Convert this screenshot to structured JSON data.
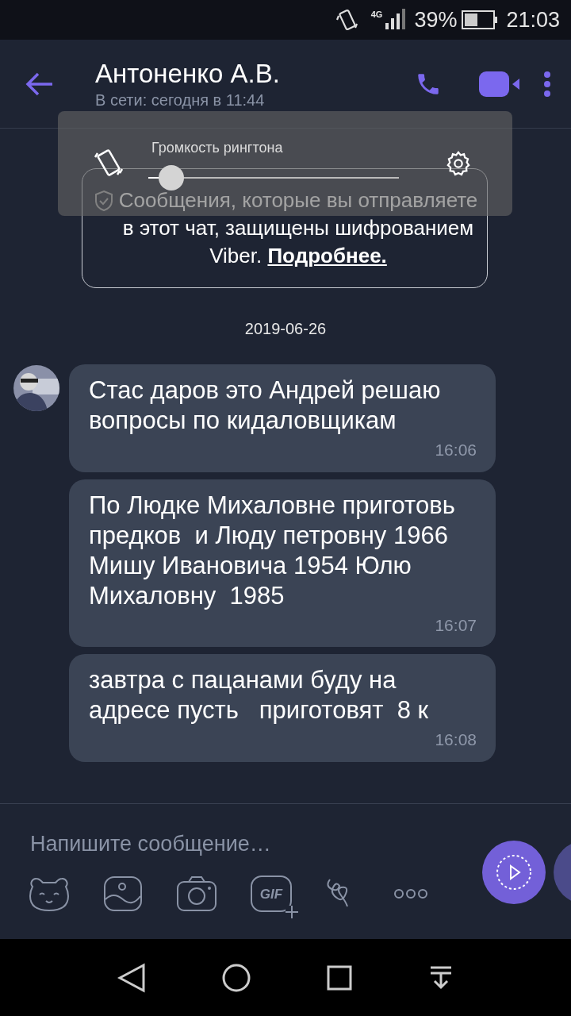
{
  "status_bar": {
    "network": "4G",
    "battery": "39%",
    "time": "21:03"
  },
  "header": {
    "title": "Антоненко А.В.",
    "subtitle": "В сети: сегодня в 11:44"
  },
  "volume_popup": {
    "label": "Громкость рингтона",
    "level": 0.04
  },
  "encryption_notice": {
    "text": "Сообщения, которые вы отправляете в этот чат, защищены шифрованием Viber.",
    "link": "Подробнее."
  },
  "date_separator": "2019-06-26",
  "messages": [
    {
      "text": "Стас даров это Андрей решаю вопросы по кидаловщикам",
      "time": "16:06",
      "show_avatar": true
    },
    {
      "text": "По Людке Михаловне приготовь предков  и Люду петровну 1966 Мишу Ивановича 1954 Юлю Михаловну  1985",
      "time": "16:07",
      "show_avatar": false
    },
    {
      "text": "завтра с пацанами буду на адресе пусть   приготовят  8 к",
      "time": "16:08",
      "show_avatar": false
    }
  ],
  "composer": {
    "placeholder": "Напишите сообщение…",
    "gif_label": "GIF"
  }
}
